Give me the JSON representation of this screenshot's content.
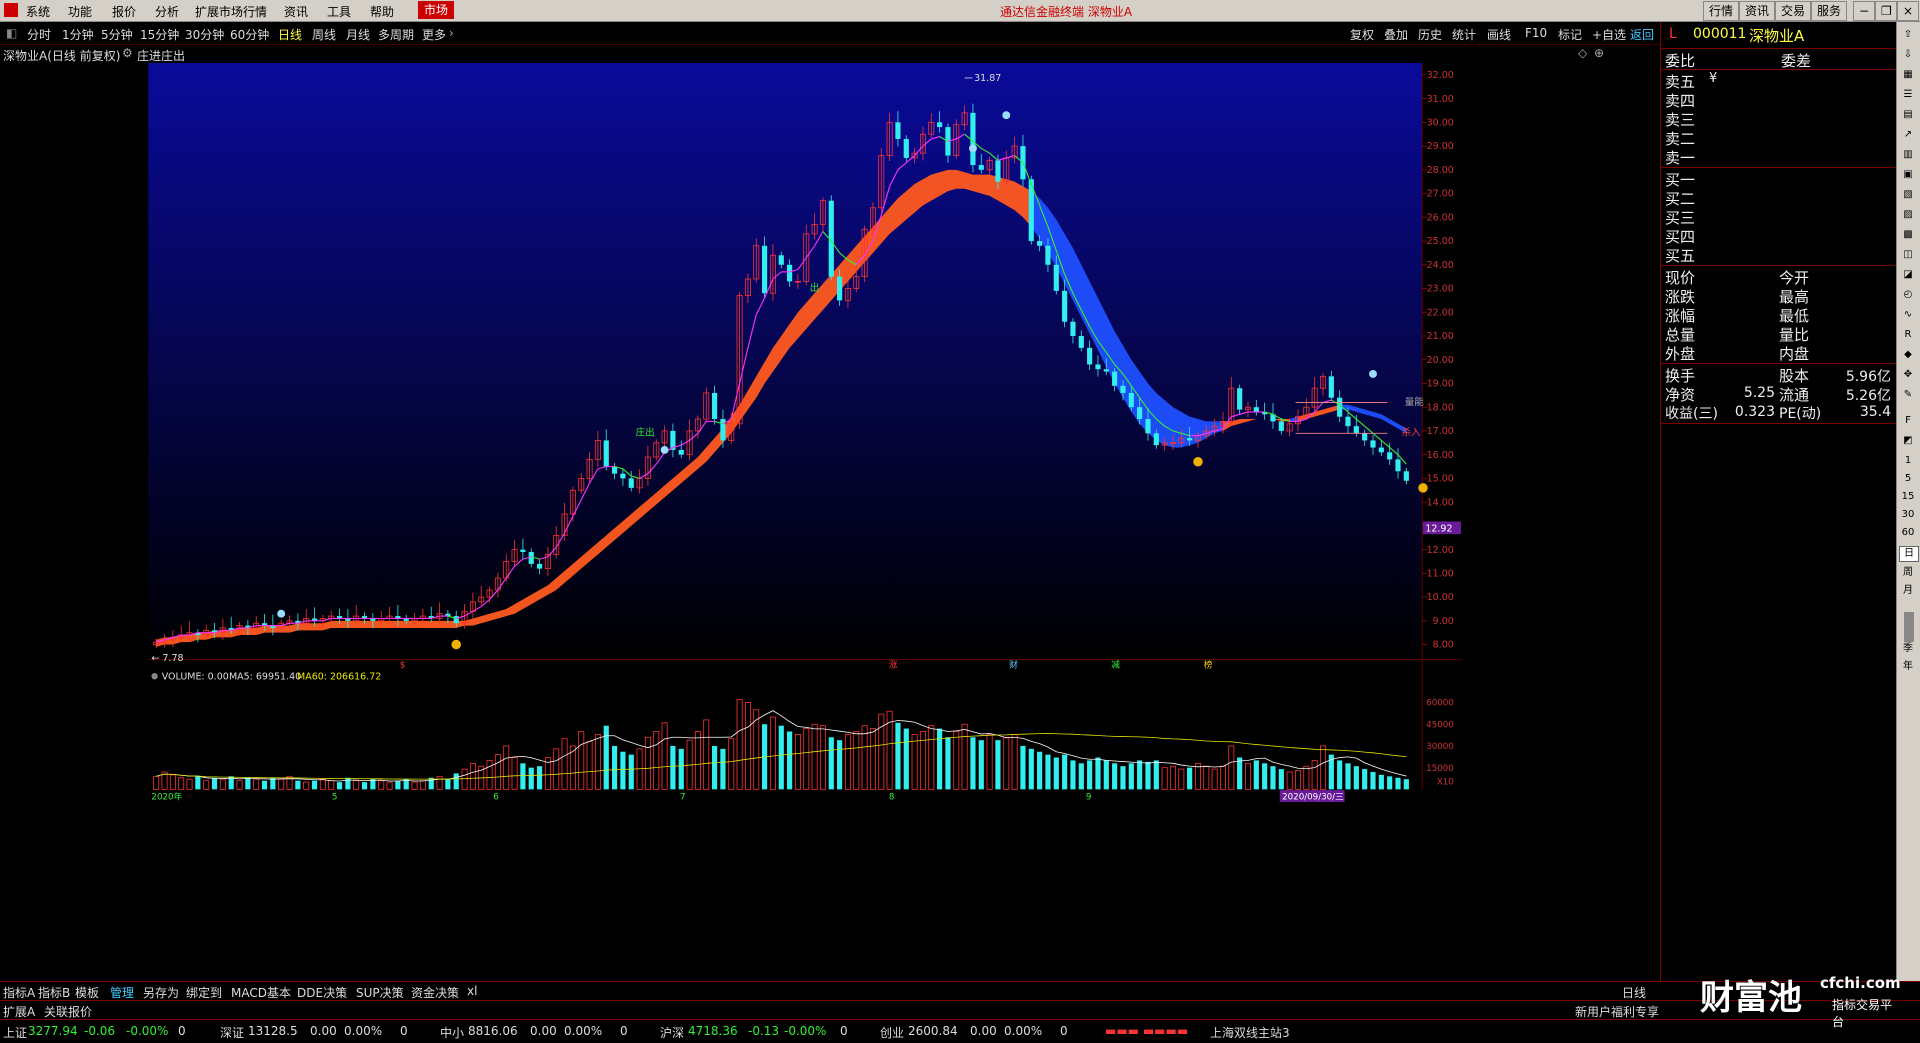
{
  "menubar": {
    "items": [
      "系统",
      "功能",
      "报价",
      "分析",
      "扩展市场行情",
      "资讯",
      "工具",
      "帮助"
    ],
    "market_tab": "市场",
    "title": "通达信金融终端  深物业A",
    "right_buttons": [
      "行情",
      "资讯",
      "交易",
      "服务"
    ]
  },
  "toolbar": {
    "periods": [
      "分时",
      "1分钟",
      "5分钟",
      "15分钟",
      "30分钟",
      "60分钟",
      "日线",
      "周线",
      "月线",
      "多周期",
      "更多"
    ],
    "active_period": "日线",
    "right_items": [
      "复权",
      "叠加",
      "历史",
      "统计",
      "画线",
      "F10",
      "标记",
      "+自选",
      "返回"
    ]
  },
  "chart_header": {
    "title": "深物业A(日线 前复权)",
    "indicator": "庄进庄出"
  },
  "chart_data": {
    "type": "candlestick",
    "title": "深物业A(日线 前复权)",
    "ylim": [
      7.5,
      32.5
    ],
    "y_ticks": [
      "32.00",
      "31.00",
      "30.00",
      "29.00",
      "28.00",
      "27.00",
      "26.00",
      "25.00",
      "24.00",
      "23.00",
      "22.00",
      "21.00",
      "20.00",
      "19.00",
      "18.00",
      "17.00",
      "16.00",
      "15.00",
      "14.00",
      "13.00",
      "12.00",
      "11.00",
      "10.00",
      "9.00",
      "8.00"
    ],
    "month_labels": [
      "2020年",
      "5",
      "6",
      "7",
      "8",
      "9"
    ],
    "high_mark": "31.87",
    "low_mark": "7.78",
    "current_price_tag": "12.92",
    "annotations": [
      "庄出",
      "出",
      "量能",
      "杀入"
    ],
    "event_markers": [
      "$",
      "涨",
      "财",
      "减",
      "榜"
    ],
    "closes": [
      8.1,
      8.2,
      8.3,
      8.4,
      8.5,
      8.4,
      8.6,
      8.5,
      8.7,
      8.6,
      8.8,
      8.7,
      8.9,
      8.8,
      8.7,
      8.9,
      9.0,
      8.9,
      9.1,
      9.0,
      9.1,
      9.2,
      9.1,
      9.0,
      9.2,
      9.1,
      9.0,
      9.1,
      9.2,
      9.1,
      9.0,
      9.1,
      9.2,
      9.1,
      9.3,
      9.2,
      8.9,
      9.4,
      9.8,
      10.0,
      10.3,
      10.8,
      11.5,
      12.0,
      11.9,
      11.4,
      11.2,
      11.8,
      12.6,
      13.5,
      14.5,
      15.0,
      15.8,
      16.6,
      15.5,
      15.2,
      15.0,
      14.6,
      15.0,
      15.9,
      16.5,
      17.0,
      16.2,
      16.0,
      17.0,
      17.5,
      18.6,
      17.5,
      16.6,
      17.3,
      22.7,
      23.4,
      24.8,
      22.8,
      24.4,
      24.0,
      23.3,
      23.3,
      25.3,
      25.7,
      26.7,
      23.5,
      22.5,
      23.0,
      23.5,
      25.5,
      26.4,
      28.6,
      30.0,
      29.3,
      28.5,
      28.7,
      29.5,
      30.0,
      29.8,
      28.6,
      29.9,
      30.4,
      28.2,
      28.0,
      28.4,
      27.5,
      28.5,
      29.0,
      27.6,
      25.0,
      24.8,
      24.0,
      22.9,
      21.6,
      21.0,
      20.5,
      19.8,
      19.6,
      19.5,
      18.9,
      18.6,
      18.0,
      17.5,
      16.9,
      16.4,
      16.5,
      16.5,
      16.7,
      16.6,
      16.8,
      17.0,
      17.2,
      17.4,
      18.8,
      17.9,
      18.0,
      17.8,
      17.7,
      17.4,
      17.0,
      17.3,
      17.6,
      18.0,
      18.8,
      19.3,
      18.4,
      17.6,
      17.2,
      16.9,
      16.6,
      16.3,
      16.1,
      15.8,
      15.3,
      14.9
    ],
    "ma_fast": [
      8.1,
      8.2,
      8.3,
      8.4,
      8.4,
      8.5,
      8.5,
      8.5,
      8.6,
      8.6,
      8.7,
      8.7,
      8.8,
      8.8,
      8.8,
      8.8,
      8.9,
      8.9,
      9.0,
      9.0,
      9.0,
      9.1,
      9.1,
      9.1,
      9.1,
      9.1,
      9.1,
      9.1,
      9.1,
      9.1,
      9.1,
      9.1,
      9.1,
      9.1,
      9.2,
      9.2,
      9.1,
      9.2,
      9.4,
      9.6,
      9.9,
      10.3,
      10.8,
      11.3,
      11.6,
      11.7,
      11.6,
      11.7,
      12.1,
      12.7,
      13.4,
      14.1,
      14.8,
      15.4,
      15.5,
      15.5,
      15.4,
      15.1,
      15.0,
      15.2,
      15.6,
      16.1,
      16.3,
      16.4,
      16.6,
      16.9,
      17.4,
      17.4,
      17.3,
      17.5,
      19.0,
      20.5,
      21.9,
      22.6,
      23.4,
      23.7,
      23.7,
      23.8,
      24.3,
      24.8,
      25.4,
      25.0,
      24.5,
      24.2,
      24.0,
      24.4,
      25.0,
      26.1,
      27.3,
      28.0,
      28.3,
      28.6,
      29.0,
      29.3,
      29.4,
      29.2,
      29.3,
      29.5,
      29.2,
      28.9,
      28.7,
      28.4,
      28.5,
      28.6,
      28.3,
      27.4,
      26.5,
      25.6,
      24.6,
      23.6,
      22.8,
      22.1,
      21.4,
      20.8,
      20.3,
      19.8,
      19.4,
      18.9,
      18.4,
      17.9,
      17.5,
      17.2,
      17.0,
      16.9,
      16.8,
      16.8,
      16.9,
      17.0,
      17.1,
      17.6,
      17.7,
      17.8,
      17.8,
      17.8,
      17.7,
      17.5,
      17.4,
      17.4,
      17.5,
      17.8,
      18.2,
      18.3,
      18.1,
      17.8,
      17.5,
      17.2,
      16.9,
      16.6,
      16.3,
      16.0,
      15.6
    ],
    "band_upper": [
      8.2,
      8.3,
      8.3,
      8.4,
      8.4,
      8.5,
      8.5,
      8.6,
      8.6,
      8.6,
      8.7,
      8.7,
      8.7,
      8.8,
      8.8,
      8.8,
      8.8,
      8.9,
      8.9,
      8.9,
      8.9,
      9.0,
      9.0,
      9.0,
      9.0,
      9.0,
      9.0,
      9.0,
      9.0,
      9.0,
      9.0,
      9.0,
      9.0,
      9.0,
      9.0,
      9.0,
      9.0,
      9.0,
      9.1,
      9.2,
      9.3,
      9.4,
      9.5,
      9.7,
      9.9,
      10.1,
      10.3,
      10.5,
      10.8,
      11.1,
      11.4,
      11.7,
      12.0,
      12.3,
      12.6,
      12.9,
      13.2,
      13.5,
      13.8,
      14.1,
      14.4,
      14.7,
      15.0,
      15.3,
      15.6,
      15.9,
      16.3,
      16.7,
      17.1,
      17.6,
      18.1,
      18.7,
      19.3,
      19.9,
      20.5,
      21.0,
      21.5,
      22.0,
      22.4,
      22.8,
      23.2,
      23.6,
      24.0,
      24.4,
      24.8,
      25.2,
      25.6,
      26.0,
      26.4,
      26.8,
      27.1,
      27.4,
      27.6,
      27.8,
      27.9,
      28.0,
      28.0,
      27.9,
      27.8,
      27.8,
      27.8,
      27.7,
      27.6,
      27.5,
      27.3,
      27.1,
      26.8,
      26.4,
      25.9,
      25.3,
      24.7,
      24.0,
      23.3,
      22.6,
      21.9,
      21.2,
      20.6,
      20.0,
      19.5,
      19.0,
      18.6,
      18.3,
      18.0,
      17.8,
      17.6,
      17.5,
      17.4,
      17.4,
      17.4,
      17.4,
      17.5,
      17.5,
      17.5,
      17.5,
      17.5,
      17.5,
      17.5,
      17.6,
      17.7,
      17.8,
      17.9,
      18.0,
      18.1,
      18.1,
      18.0,
      17.9,
      17.8,
      17.7,
      17.5,
      17.3,
      17.1
    ],
    "band_lower": [
      7.9,
      8.0,
      8.0,
      8.1,
      8.1,
      8.2,
      8.2,
      8.3,
      8.3,
      8.3,
      8.4,
      8.4,
      8.4,
      8.5,
      8.5,
      8.5,
      8.5,
      8.6,
      8.6,
      8.6,
      8.6,
      8.7,
      8.7,
      8.7,
      8.7,
      8.7,
      8.7,
      8.7,
      8.7,
      8.7,
      8.7,
      8.7,
      8.7,
      8.7,
      8.7,
      8.7,
      8.7,
      8.8,
      8.8,
      8.9,
      9.0,
      9.1,
      9.2,
      9.3,
      9.5,
      9.7,
      9.9,
      10.1,
      10.3,
      10.6,
      10.9,
      11.2,
      11.5,
      11.8,
      12.1,
      12.4,
      12.7,
      13.0,
      13.3,
      13.6,
      13.9,
      14.2,
      14.5,
      14.8,
      15.1,
      15.4,
      15.7,
      16.1,
      16.5,
      16.9,
      17.4,
      17.9,
      18.4,
      19.0,
      19.5,
      20.0,
      20.5,
      20.9,
      21.3,
      21.7,
      22.1,
      22.5,
      22.9,
      23.3,
      23.7,
      24.1,
      24.5,
      24.9,
      25.3,
      25.6,
      25.9,
      26.2,
      26.5,
      26.7,
      26.9,
      27.1,
      27.2,
      27.2,
      27.1,
      27.0,
      26.9,
      26.7,
      26.5,
      26.3,
      26.0,
      25.6,
      25.1,
      24.5,
      23.9,
      23.2,
      22.5,
      21.8,
      21.1,
      20.4,
      19.7,
      19.0,
      18.4,
      17.8,
      17.3,
      16.9,
      16.6,
      16.4,
      16.3,
      16.3,
      16.4,
      16.5,
      16.7,
      16.9,
      17.0,
      17.2,
      17.3,
      17.4,
      17.5,
      17.5,
      17.5,
      17.4,
      17.4,
      17.4,
      17.5,
      17.6,
      17.7,
      17.8,
      17.9,
      17.9,
      17.8,
      17.7,
      17.6,
      17.5,
      17.3,
      17.1,
      16.9
    ],
    "volume": {
      "label": "VOLUME: 0.00",
      "ma5_label": "MA5: 69951.40",
      "ma60_label": "MA60: 206616.72",
      "ylim": [
        0,
        70000
      ],
      "y_ticks": [
        "60000",
        "45000",
        "30000",
        "15000",
        "X10"
      ],
      "date_tag": "2020/09/30/三",
      "values": [
        9000,
        12000,
        10000,
        8000,
        7000,
        9000,
        6000,
        8000,
        7000,
        9000,
        6000,
        8000,
        7000,
        6000,
        8000,
        7000,
        9000,
        6000,
        5000,
        6000,
        7000,
        6000,
        5000,
        8000,
        6000,
        5000,
        7000,
        6000,
        5000,
        6000,
        7000,
        5000,
        6000,
        8000,
        9000,
        7000,
        11000,
        14000,
        18000,
        16000,
        20000,
        24000,
        30000,
        22000,
        18000,
        15000,
        16000,
        22000,
        28000,
        35000,
        30000,
        40000,
        33000,
        38000,
        44000,
        30000,
        26000,
        24000,
        28000,
        36000,
        40000,
        46000,
        30000,
        28000,
        34000,
        40000,
        48000,
        30000,
        28000,
        35000,
        62000,
        60000,
        55000,
        45000,
        50000,
        44000,
        40000,
        38000,
        42000,
        45000,
        44000,
        36000,
        34000,
        38000,
        40000,
        44000,
        42000,
        52000,
        54000,
        46000,
        42000,
        38000,
        40000,
        44000,
        42000,
        36000,
        40000,
        45000,
        36000,
        34000,
        38000,
        34000,
        36000,
        38000,
        30000,
        28000,
        26000,
        24000,
        22000,
        24000,
        20000,
        18000,
        20000,
        22000,
        20000,
        18000,
        16000,
        18000,
        20000,
        19000,
        20000,
        15000,
        16000,
        14000,
        15000,
        18000,
        16000,
        14000,
        16000,
        30000,
        22000,
        18000,
        20000,
        18000,
        16000,
        14000,
        12000,
        13000,
        16000,
        20000,
        30000,
        24000,
        20000,
        18000,
        16000,
        14000,
        12000,
        10000,
        9000,
        8000,
        7000
      ]
    }
  },
  "quote_panel": {
    "code": "000011",
    "name": "深物业A",
    "prefix": "L",
    "order_ratio_label": "委比",
    "order_diff_label": "委差",
    "asks": [
      "卖五",
      "卖四",
      "卖三",
      "卖二",
      "卖一"
    ],
    "ask_currency": "¥",
    "bids": [
      "买一",
      "买二",
      "买三",
      "买四",
      "买五"
    ],
    "stats_left": [
      "现价",
      "涨跌",
      "涨幅",
      "总量",
      "外盘"
    ],
    "stats_right": [
      "今开",
      "最高",
      "最低",
      "量比",
      "内盘"
    ],
    "fund_rows": [
      {
        "l": "换手",
        "lv": "",
        "r": "股本",
        "rv": "5.96亿"
      },
      {
        "l": "净资",
        "lv": "5.25",
        "r": "流通",
        "rv": "5.26亿"
      },
      {
        "l": "收益(三)",
        "lv": "0.323",
        "r": "PE(动)",
        "rv": "35.4"
      }
    ]
  },
  "icon_strip": [
    "1",
    "5",
    "15",
    "30",
    "60",
    "日",
    "周",
    "月",
    "年",
    "季",
    "年"
  ],
  "indicator_tabs": [
    "指标A",
    "指标B",
    "模板",
    "管理",
    "另存为",
    "绑定到",
    "MACD基本",
    "DDE决策",
    "SUP决策",
    "资金决策",
    "xl"
  ],
  "indicator_tabs_active": "管理",
  "lower_tabs": [
    "扩展A",
    "关联报价"
  ],
  "right_period_label": "日线",
  "statusbar": {
    "indices": [
      {
        "name": "上证",
        "value": "3277.94",
        "chg": "-0.06",
        "pct": "-0.00%",
        "vol": "0"
      },
      {
        "name": "深证",
        "value": "13128.5",
        "chg": "0.00",
        "pct": "0.00%",
        "vol": "0"
      },
      {
        "name": "中小",
        "value": "8816.06",
        "chg": "0.00",
        "pct": "0.00%",
        "vol": "0"
      },
      {
        "name": "沪深",
        "value": "4718.36",
        "chg": "-0.13",
        "pct": "-0.00%",
        "vol": "0"
      },
      {
        "name": "创业",
        "value": "2600.84",
        "chg": "0.00",
        "pct": "0.00%",
        "vol": "0"
      }
    ],
    "server": "上海双线主站3",
    "promo": "新用户福利专享"
  },
  "watermark": {
    "logo": "财富池",
    "url": "cfchi.com",
    "sub": "指标交易平台"
  },
  "colors": {
    "up": "#ff3333",
    "down": "#33eeee",
    "ma_fast_up": "#ff33ff",
    "ma_fast_down": "#33ee33",
    "band_up": "#ff5a1f",
    "band_down": "#1f4fff",
    "vol_ma5": "#ffffff",
    "vol_ma60": "#e6e600",
    "grid": "#700000",
    "bg_top": "#0a0a9a",
    "bg_bottom": "#000000"
  }
}
